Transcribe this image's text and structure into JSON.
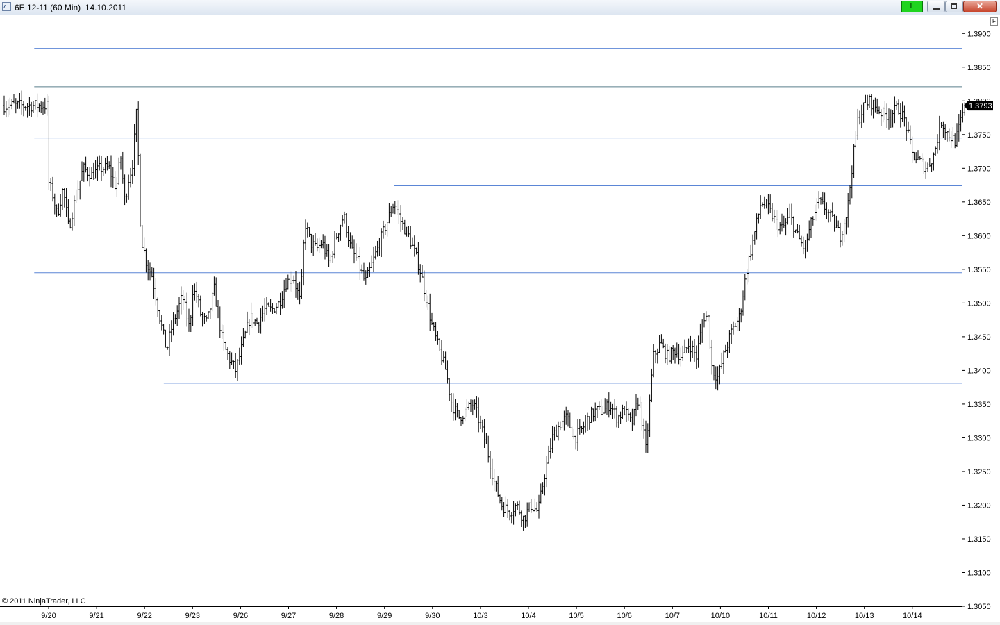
{
  "window": {
    "title": "6E 12-11 (60 Min)  14.10.2011",
    "link_label": "L",
    "close_glyph": "✕",
    "colors": {
      "link_green": "#1fd41f",
      "close_red": "#c7452c"
    }
  },
  "chart_panel": {
    "f_button_label": "F",
    "copyright": "© 2011 NinjaTrader, LLC"
  },
  "chart_data": {
    "type": "ohlc",
    "instrument": "6E 12-11",
    "interval": "60 Min",
    "date": "14.10.2011",
    "y_ticks": [
      "1.3900",
      "1.3850",
      "1.3800",
      "1.3750",
      "1.3700",
      "1.3650",
      "1.3600",
      "1.3550",
      "1.3500",
      "1.3450",
      "1.3400",
      "1.3350",
      "1.3300",
      "1.3250",
      "1.3200",
      "1.3150",
      "1.3100",
      "1.3050"
    ],
    "ylim": [
      1.305,
      1.3925
    ],
    "x_labels": [
      "9/20",
      "9/21",
      "9/22",
      "9/23",
      "9/26",
      "9/27",
      "9/28",
      "9/29",
      "9/30",
      "10/3",
      "10/4",
      "10/5",
      "10/6",
      "10/7",
      "10/10",
      "10/11",
      "10/12",
      "10/13",
      "10/14"
    ],
    "last_price": "1.3793",
    "price_path": [
      [
        0,
        1.368
      ],
      [
        0.03,
        1.366
      ],
      [
        0.06,
        1.363
      ],
      [
        0.1,
        1.367
      ],
      [
        0.14,
        1.361
      ],
      [
        0.18,
        1.365
      ],
      [
        0.24,
        1.37
      ],
      [
        0.3,
        1.369
      ],
      [
        0.36,
        1.37
      ],
      [
        0.42,
        1.37
      ],
      [
        0.47,
        1.367
      ],
      [
        0.5,
        1.372
      ],
      [
        0.53,
        1.365
      ],
      [
        0.56,
        1.369
      ],
      [
        0.58,
        1.37
      ],
      [
        0.61,
        1.378
      ],
      [
        0.62,
        1.374
      ],
      [
        0.64,
        1.36
      ],
      [
        0.68,
        1.356
      ],
      [
        0.72,
        1.354
      ],
      [
        0.78,
        1.347
      ],
      [
        0.82,
        1.343
      ],
      [
        0.85,
        1.346
      ],
      [
        0.88,
        1.348
      ],
      [
        0.93,
        1.351
      ],
      [
        0.98,
        1.346
      ],
      [
        1.0,
        1.352
      ],
      [
        1.03,
        1.351
      ],
      [
        1.06,
        1.348
      ],
      [
        1.1,
        1.347
      ],
      [
        1.15,
        1.352
      ],
      [
        1.18,
        1.348
      ],
      [
        1.21,
        1.344
      ],
      [
        1.25,
        1.342
      ],
      [
        1.3,
        1.34
      ],
      [
        1.35,
        1.344
      ],
      [
        1.4,
        1.348
      ],
      [
        1.45,
        1.347
      ],
      [
        1.5,
        1.349
      ],
      [
        1.55,
        1.349
      ],
      [
        1.6,
        1.35
      ],
      [
        1.65,
        1.353
      ],
      [
        1.7,
        1.354
      ],
      [
        1.75,
        1.35
      ],
      [
        1.78,
        1.362
      ],
      [
        1.82,
        1.359
      ],
      [
        1.86,
        1.358
      ],
      [
        1.9,
        1.359
      ],
      [
        1.95,
        1.356
      ],
      [
        2.0,
        1.36
      ],
      [
        2.05,
        1.363
      ],
      [
        2.1,
        1.358
      ],
      [
        2.15,
        1.356
      ],
      [
        2.2,
        1.353
      ],
      [
        2.25,
        1.356
      ],
      [
        2.3,
        1.359
      ],
      [
        2.35,
        1.362
      ],
      [
        2.4,
        1.365
      ],
      [
        2.45,
        1.362
      ],
      [
        2.5,
        1.36
      ],
      [
        2.55,
        1.357
      ],
      [
        2.58,
        1.355
      ],
      [
        2.62,
        1.351
      ],
      [
        2.66,
        1.347
      ],
      [
        2.7,
        1.344
      ],
      [
        2.73,
        1.342
      ],
      [
        2.76,
        1.34
      ],
      [
        2.8,
        1.335
      ],
      [
        2.85,
        1.333
      ],
      [
        2.9,
        1.334
      ],
      [
        2.95,
        1.335
      ],
      [
        3.0,
        1.332
      ],
      [
        3.05,
        1.328
      ],
      [
        3.1,
        1.323
      ],
      [
        3.15,
        1.32
      ],
      [
        3.2,
        1.319
      ],
      [
        3.25,
        1.32
      ],
      [
        3.3,
        1.318
      ],
      [
        3.35,
        1.32
      ],
      [
        3.4,
        1.319
      ],
      [
        3.45,
        1.325
      ],
      [
        3.5,
        1.33
      ],
      [
        3.55,
        1.332
      ],
      [
        3.6,
        1.333
      ],
      [
        3.65,
        1.33
      ],
      [
        3.7,
        1.331
      ],
      [
        3.75,
        1.333
      ],
      [
        3.8,
        1.334
      ],
      [
        3.85,
        1.334
      ],
      [
        3.9,
        1.335
      ],
      [
        3.95,
        1.333
      ],
      [
        4.0,
        1.334
      ],
      [
        4.05,
        1.332
      ],
      [
        4.1,
        1.336
      ],
      [
        4.15,
        1.328
      ],
      [
        4.2,
        1.342
      ],
      [
        4.25,
        1.344
      ],
      [
        4.3,
        1.342
      ],
      [
        4.35,
        1.343
      ],
      [
        4.4,
        1.342
      ],
      [
        4.45,
        1.344
      ],
      [
        4.5,
        1.342
      ],
      [
        4.55,
        1.348
      ],
      [
        4.58,
        1.348
      ],
      [
        4.61,
        1.34
      ],
      [
        4.65,
        1.339
      ],
      [
        4.7,
        1.343
      ],
      [
        4.75,
        1.346
      ],
      [
        4.8,
        1.348
      ],
      [
        4.85,
        1.355
      ],
      [
        4.9,
        1.36
      ],
      [
        4.95,
        1.365
      ],
      [
        5.0,
        1.364
      ],
      [
        5.05,
        1.362
      ],
      [
        5.1,
        1.361
      ],
      [
        5.15,
        1.363
      ],
      [
        5.2,
        1.36
      ],
      [
        5.25,
        1.358
      ],
      [
        5.3,
        1.362
      ],
      [
        5.35,
        1.365
      ],
      [
        5.4,
        1.364
      ],
      [
        5.45,
        1.362
      ],
      [
        5.5,
        1.36
      ],
      [
        5.55,
        1.364
      ],
      [
        5.58,
        1.37
      ],
      [
        5.62,
        1.377
      ],
      [
        5.66,
        1.379
      ],
      [
        5.7,
        1.38
      ],
      [
        5.75,
        1.379
      ],
      [
        5.8,
        1.378
      ],
      [
        5.85,
        1.378
      ],
      [
        5.9,
        1.379
      ],
      [
        5.95,
        1.377
      ],
      [
        6.0,
        1.372
      ],
      [
        6.05,
        1.371
      ],
      [
        6.1,
        1.37
      ],
      [
        6.15,
        1.372
      ],
      [
        6.2,
        1.377
      ],
      [
        6.25,
        1.375
      ],
      [
        6.3,
        1.374
      ],
      [
        6.35,
        1.378
      ],
      [
        6.37,
        1.3793
      ]
    ],
    "horizontal_lines": [
      {
        "price": 1.3878,
        "x_start": -0.1,
        "x_end": 6.7,
        "color": "#5b86d6"
      },
      {
        "price": 1.3821,
        "x_start": -0.1,
        "x_end": 6.7,
        "color": "#5a7f8c"
      },
      {
        "price": 1.3745,
        "x_start": -0.1,
        "x_end": 6.7,
        "color": "#5b86d6"
      },
      {
        "price": 1.3674,
        "x_start": 2.4,
        "x_end": 6.7,
        "color": "#5b86d6"
      },
      {
        "price": 1.3545,
        "x_start": -0.1,
        "x_end": 6.7,
        "color": "#5b86d6"
      },
      {
        "price": 1.3381,
        "x_start": 0.8,
        "x_end": 6.35,
        "color": "#5b86d6"
      }
    ]
  }
}
